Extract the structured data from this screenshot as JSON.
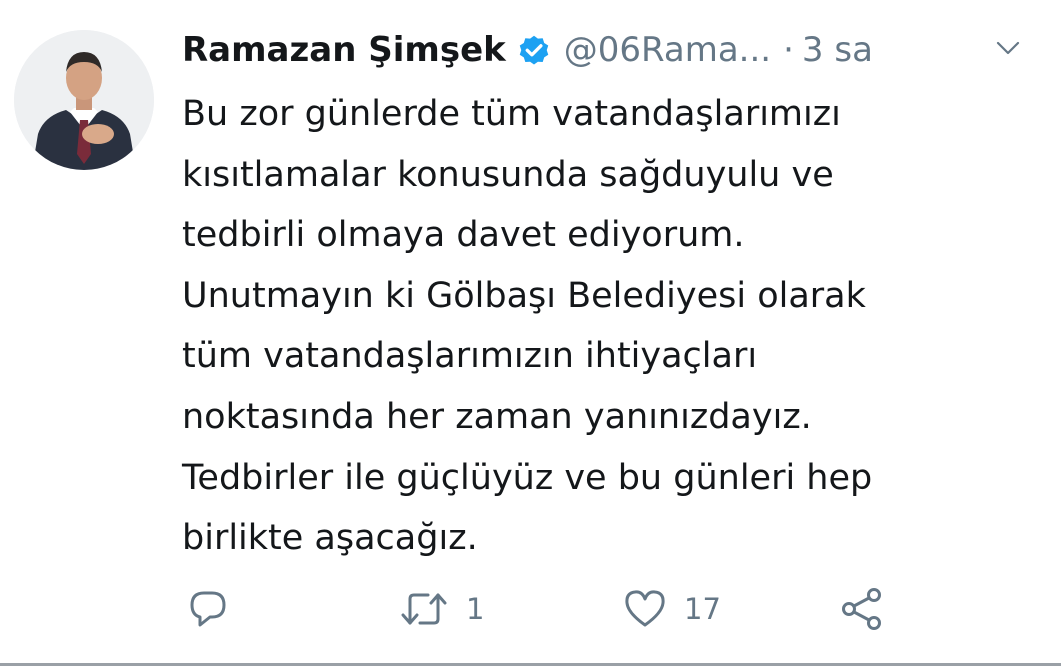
{
  "tweet": {
    "author_name": "Ramazan Şimşek",
    "handle": "@06Rama...",
    "separator": "·",
    "time": "3 sa",
    "verified": true,
    "text_lines": [
      "Bu zor günlerde tüm vatandaşlarımızı",
      "kısıtlamalar konusunda sağduyulu ve",
      "tedbirli olmaya davet ediyorum.",
      "Unutmayın ki Gölbaşı Belediyesi olarak",
      "tüm vatandaşlarımızın ihtiyaçları",
      "noktasında her zaman yanınızdayız.",
      "Tedbirler ile güçlüyüz ve bu günleri hep",
      "birlikte aşacağız."
    ]
  },
  "actions": {
    "reply_icon": "reply-icon",
    "retweet_icon": "retweet-icon",
    "retweet_count": "1",
    "like_icon": "heart-icon",
    "like_count": "17",
    "share_icon": "share-icon"
  },
  "colors": {
    "text": "#14171a",
    "muted": "#657786",
    "verified_blue": "#1da1f2"
  }
}
